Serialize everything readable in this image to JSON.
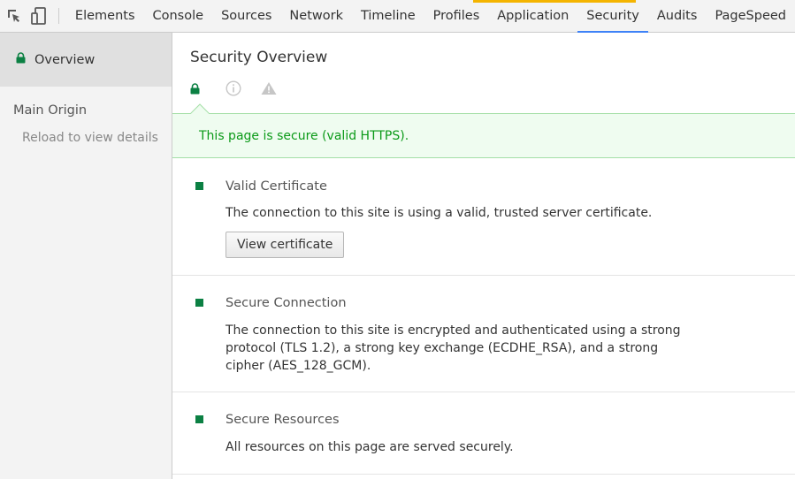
{
  "toolbar": {
    "tabs": [
      {
        "label": "Elements"
      },
      {
        "label": "Console"
      },
      {
        "label": "Sources"
      },
      {
        "label": "Network"
      },
      {
        "label": "Timeline"
      },
      {
        "label": "Profiles"
      },
      {
        "label": "Application"
      },
      {
        "label": "Security"
      },
      {
        "label": "Audits"
      },
      {
        "label": "PageSpeed"
      }
    ],
    "active_tab": "Security",
    "icons": [
      "inspect-element-icon",
      "device-toolbar-icon"
    ]
  },
  "sidebar": {
    "overview_label": "Overview",
    "main_origin_label": "Main Origin",
    "reload_hint": "Reload to view details"
  },
  "main": {
    "title": "Security Overview",
    "summary_icons": [
      "lock-icon",
      "info-icon",
      "warning-icon"
    ],
    "secure_message": "This page is secure (valid HTTPS).",
    "sections": [
      {
        "title": "Valid Certificate",
        "text": "The connection to this site is using a valid, trusted server certificate.",
        "button": "View certificate"
      },
      {
        "title": "Secure Connection",
        "text": "The connection to this site is encrypted and authenticated using a strong protocol (TLS 1.2), a strong key exchange (ECDHE_RSA), and a strong cipher (AES_128_GCM)."
      },
      {
        "title": "Secure Resources",
        "text": "All resources on this page are served securely."
      }
    ]
  },
  "colors": {
    "secure_green": "#0b9a18",
    "active_tab_underline": "#3e82f7",
    "secure_bar_bg": "#effcf0"
  }
}
